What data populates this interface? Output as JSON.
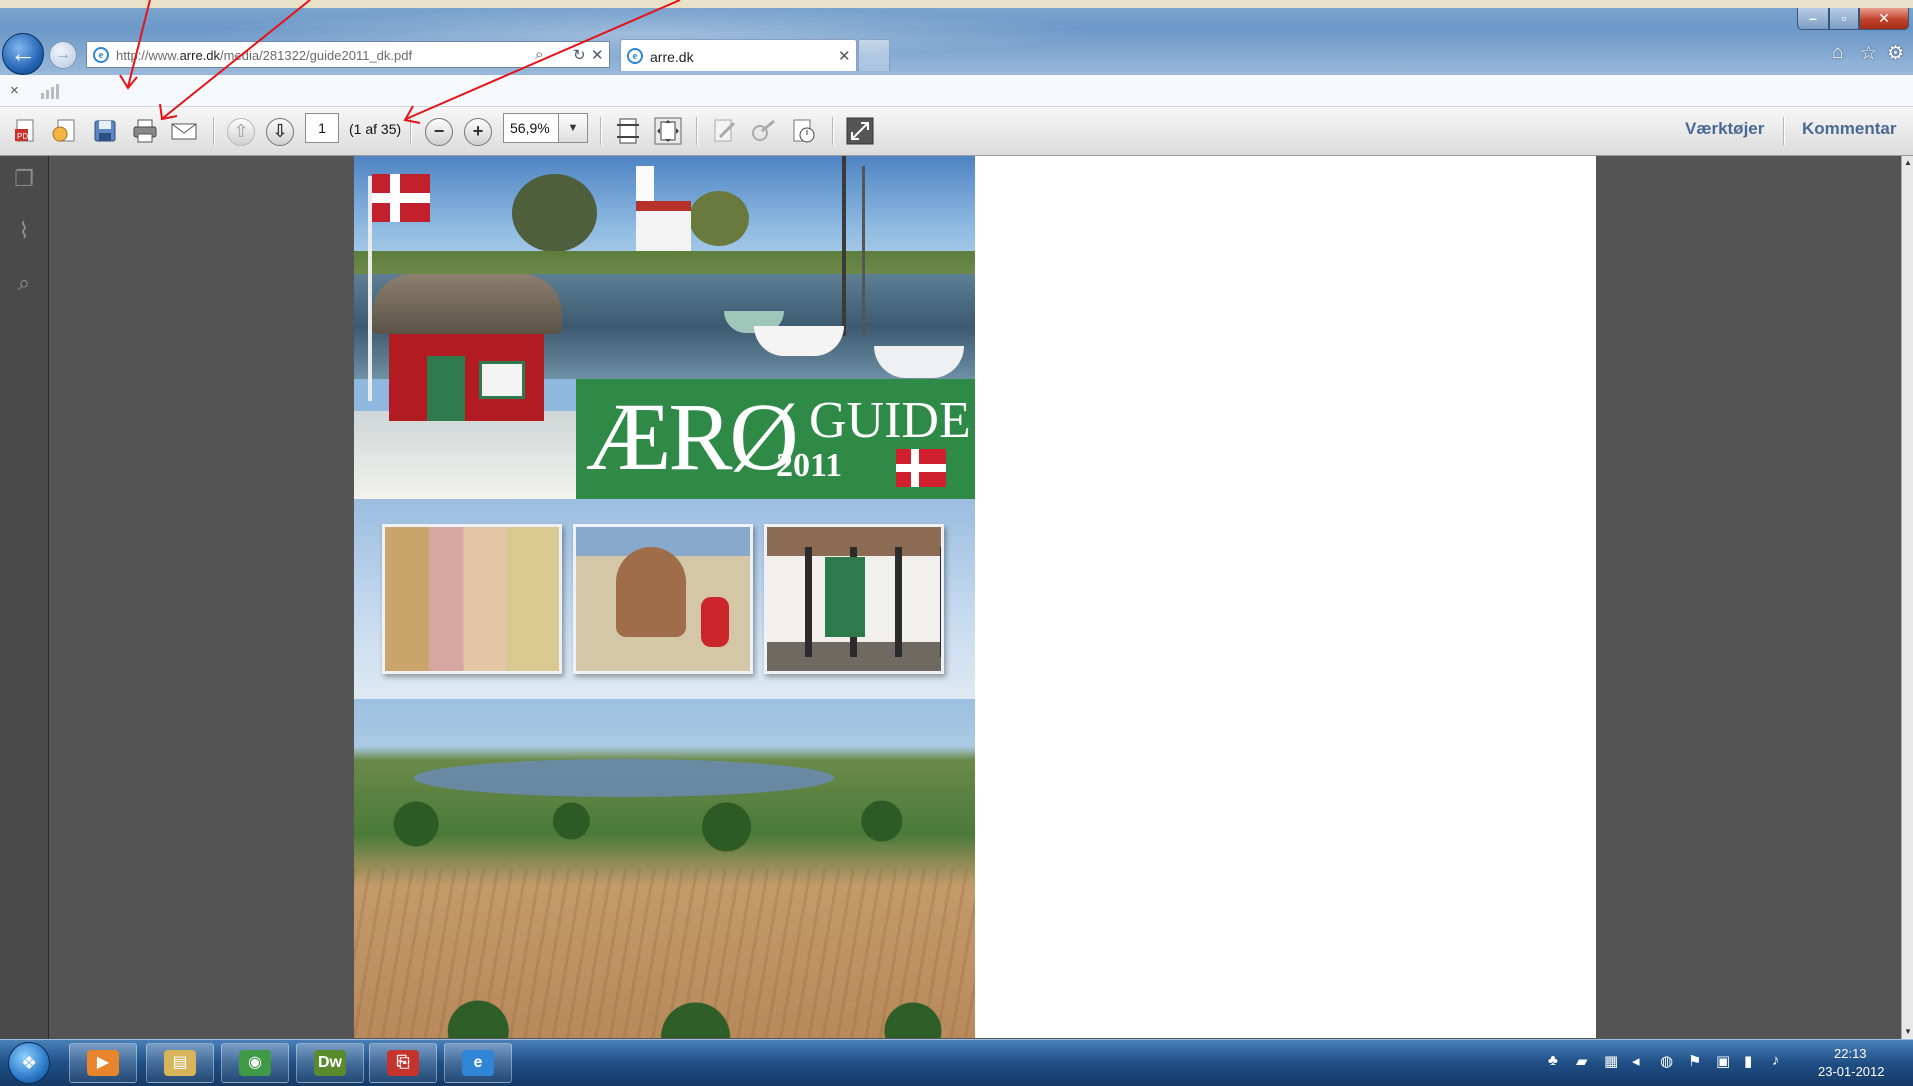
{
  "browser": {
    "address": {
      "url_prefix": "http://www.",
      "url_domain": "arre.dk",
      "url_path": "/media/281322/guide2011_dk.pdf",
      "ie_glyph": "e"
    },
    "tab": {
      "title": "arre.dk",
      "close": "✕"
    },
    "window_controls": {
      "minimize": "–",
      "maximize": "▫",
      "close": "✕"
    },
    "nav": {
      "back": "←",
      "forward": "→"
    },
    "addr_tools": {
      "search": "⌕",
      "refresh": "↻",
      "stop": "✕"
    },
    "right_icons": {
      "home": "⌂",
      "favorites": "☆",
      "tools": "⚙"
    },
    "command_bar": {
      "close": "×"
    }
  },
  "pdf_toolbar": {
    "page_number": "1",
    "page_count": "(1 af 35)",
    "zoom": "56,9%",
    "zoom_drop": "▼",
    "prev_page": "⇧",
    "next_page": "⇩",
    "zoom_out": "−",
    "zoom_in": "+",
    "tools_label": "Værktøjer",
    "comment_label": "Kommentar"
  },
  "left_nav": {
    "pages": "❐",
    "attachments": "⌇",
    "search": "⌕"
  },
  "document": {
    "cover_title": "ÆRØ",
    "cover_subtitle": "GUIDE",
    "cover_year": "2011"
  },
  "taskbar": {
    "start_logo": "❖",
    "apps": [
      {
        "name": "Windows Media Player",
        "glyph": "▶",
        "color": "#e8842b"
      },
      {
        "name": "Windows Explorer",
        "glyph": "▤",
        "color": "#d7b45a"
      },
      {
        "name": "Google Chrome",
        "glyph": "◉",
        "color": "#3e9a47"
      },
      {
        "name": "Dreamweaver",
        "glyph": "Dw",
        "color": "#5a8a2e"
      },
      {
        "name": "Adobe Reader",
        "glyph": "⎘",
        "color": "#c5342c"
      },
      {
        "name": "Internet Explorer",
        "glyph": "e",
        "color": "#2f86d6"
      }
    ],
    "tray_icons": [
      "♣",
      "▰",
      "▦",
      "◂",
      "◍",
      "⚑",
      "▣",
      "▮",
      "♪"
    ],
    "clock_time": "22:13",
    "clock_date": "23-01-2012"
  },
  "colors": {
    "acrobat_link": "#4a6a95",
    "cover_green": "#2f8a47",
    "danish_red": "#c3202e",
    "annotation_arrow": "#e4141b"
  }
}
